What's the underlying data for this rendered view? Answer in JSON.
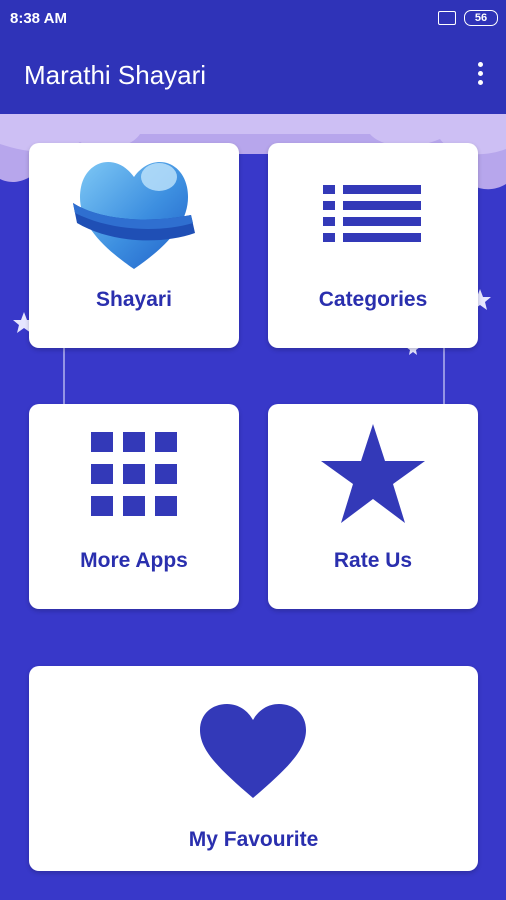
{
  "status_bar": {
    "time": "8:38 AM",
    "battery": "56"
  },
  "app_bar": {
    "title": "Marathi Shayari"
  },
  "menu": {
    "shayari": {
      "label": "Shayari",
      "icon": "heart-ribbon-icon"
    },
    "categories": {
      "label": "Categories",
      "icon": "list-icon"
    },
    "more_apps": {
      "label": "More Apps",
      "icon": "grid-icon"
    },
    "rate_us": {
      "label": "Rate Us",
      "icon": "star-icon"
    },
    "my_favourite": {
      "label": "My Favourite",
      "icon": "heart-icon"
    }
  },
  "colors": {
    "primary": "#2f33b8",
    "background": "#3838c9",
    "accent": "#3339b8",
    "card": "#ffffff"
  }
}
